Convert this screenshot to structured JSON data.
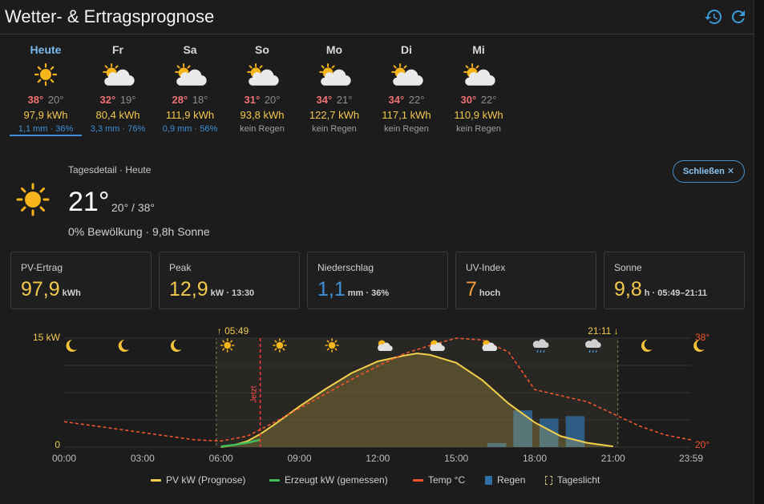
{
  "header": {
    "title": "Wetter- & Ertragsprognose"
  },
  "days": [
    {
      "name": "Heute",
      "icon": "sun-icon",
      "hi": "38°",
      "lo": "20°",
      "kwh": "97,9 kWh",
      "rain": "1,1 mm · 36%",
      "has_rain": true,
      "active": true
    },
    {
      "name": "Fr",
      "icon": "partly-cloudy-icon",
      "hi": "32°",
      "lo": "19°",
      "kwh": "80,4 kWh",
      "rain": "3,3 mm · 76%",
      "has_rain": true,
      "active": false
    },
    {
      "name": "Sa",
      "icon": "partly-cloudy-icon",
      "hi": "28°",
      "lo": "18°",
      "kwh": "111,9 kWh",
      "rain": "0,9 mm · 56%",
      "has_rain": true,
      "active": false
    },
    {
      "name": "So",
      "icon": "partly-cloudy-icon",
      "hi": "31°",
      "lo": "20°",
      "kwh": "93,8 kWh",
      "rain": "kein Regen",
      "has_rain": false,
      "active": false
    },
    {
      "name": "Mo",
      "icon": "partly-cloudy-icon",
      "hi": "34°",
      "lo": "21°",
      "kwh": "122,7 kWh",
      "rain": "kein Regen",
      "has_rain": false,
      "active": false
    },
    {
      "name": "Di",
      "icon": "partly-cloudy-icon",
      "hi": "34°",
      "lo": "22°",
      "kwh": "117,1 kWh",
      "rain": "kein Regen",
      "has_rain": false,
      "active": false
    },
    {
      "name": "Mi",
      "icon": "partly-cloudy-icon",
      "hi": "30°",
      "lo": "22°",
      "kwh": "110,9 kWh",
      "rain": "kein Regen",
      "has_rain": false,
      "active": false
    }
  ],
  "detail": {
    "label": "Tagesdetail · Heute",
    "temp": "21°",
    "range": "20° / 38°",
    "sub": "0% Bewölkung · 9,8h Sonne",
    "close_label": "Schließen ✕"
  },
  "tiles": [
    {
      "label": "PV-Ertrag",
      "value": "97,9",
      "unit": "kWh",
      "extra": "",
      "color": "#f2c94c"
    },
    {
      "label": "Peak",
      "value": "12,9",
      "unit": "kW",
      "extra": " · 13:30",
      "color": "#f2c94c"
    },
    {
      "label": "Niederschlag",
      "value": "1,1",
      "unit": "mm",
      "extra": " · 36%",
      "color": "#3c8fd8"
    },
    {
      "label": "UV-Index",
      "value": "7",
      "unit": "hoch",
      "extra": "",
      "color": "#f19b3c"
    },
    {
      "label": "Sonne",
      "value": "9,8",
      "unit": "h",
      "extra": " · 05:49–21:11",
      "color": "#f2c94c"
    }
  ],
  "chart_data": {
    "type": "line",
    "x_ticks": [
      "00:00",
      "03:00",
      "06:00",
      "09:00",
      "12:00",
      "15:00",
      "18:00",
      "21:00",
      "23:59"
    ],
    "y_left_labels": {
      "top": "15 kW",
      "bottom": "0"
    },
    "y_right_labels": {
      "top": "38°",
      "bottom": "20°"
    },
    "ylim_kw": [
      0,
      15
    ],
    "ylim_temp": [
      20,
      38
    ],
    "sunrise_label": "↑ 05:49",
    "sunset_label": "21:11 ↓",
    "now_label": "Jetzt",
    "now_hour": 7.5,
    "daylight": [
      5.82,
      21.18
    ],
    "hourly_icons": [
      "moon",
      "moon",
      "moon",
      "sun",
      "sun",
      "sun",
      "partly",
      "partly",
      "partly",
      "rain",
      "rain",
      "moon",
      "moon"
    ],
    "series": [
      {
        "name": "PV kW (Prognose)",
        "color": "#f2d04c",
        "x": [
          6,
          6.5,
          7,
          7.5,
          8,
          9,
          10,
          11,
          12,
          13,
          13.5,
          14,
          15,
          16,
          17,
          18,
          19,
          20,
          21
        ],
        "y": [
          0,
          0.3,
          0.8,
          1.8,
          3,
          5.6,
          8,
          10.2,
          11.8,
          12.6,
          12.9,
          12.7,
          11.6,
          9.2,
          6,
          3.4,
          1.5,
          0.6,
          0.1
        ]
      },
      {
        "name": "Erzeugt kW (gemessen)",
        "color": "#3fbf5a",
        "x": [
          6,
          6.5,
          7,
          7.5
        ],
        "y": [
          0.1,
          0.3,
          0.6,
          1.0
        ]
      },
      {
        "name": "Temp °C",
        "color": "#f2552d",
        "x": [
          0,
          1,
          2,
          3,
          4,
          5,
          6,
          7,
          8,
          9,
          10,
          11,
          12,
          13,
          14,
          15,
          16,
          17,
          18,
          19,
          20,
          21,
          22,
          23,
          23.98
        ],
        "y": [
          24.2,
          23.6,
          23,
          22.4,
          21.8,
          21.2,
          21,
          21.8,
          24,
          26.4,
          28.8,
          31.2,
          33.4,
          35.4,
          36.8,
          38,
          37.7,
          35.7,
          29.5,
          28.5,
          27.5,
          25.5,
          23.5,
          22,
          21.2
        ]
      },
      {
        "name": "Regen",
        "color": "#2f6fa6",
        "x": [
          16,
          17,
          18,
          19
        ],
        "y": [
          0.05,
          0.45,
          0.35,
          0.38
        ]
      },
      {
        "name": "Tageslicht",
        "color": "#c9b97a"
      }
    ]
  },
  "colors": {
    "accent": "#3d9ad8",
    "pv": "#f2c94c",
    "temp_hi": "#f07272",
    "rain": "#3c8fd8"
  }
}
